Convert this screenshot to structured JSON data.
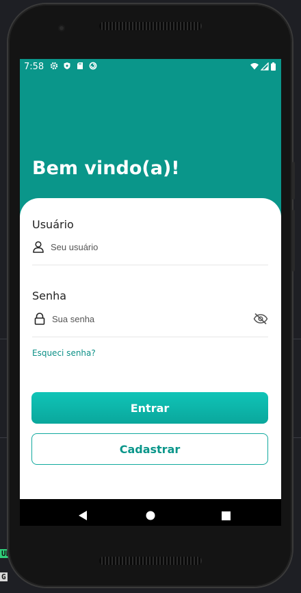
{
  "status_bar": {
    "time": "7:58",
    "left_icons": [
      "settings-icon",
      "shield-icon",
      "sd-card-icon",
      "sync-icon"
    ],
    "right_icons": [
      "wifi-icon",
      "signal-icon",
      "battery-icon"
    ]
  },
  "header": {
    "welcome": "Bem vindo(a)!"
  },
  "form": {
    "username": {
      "label": "Usuário",
      "placeholder": "Seu usuário",
      "value": ""
    },
    "password": {
      "label": "Senha",
      "placeholder": "Sua senha",
      "value": ""
    },
    "forgot_link": "Esqueci senha?",
    "login_button": "Entrar",
    "register_button": "Cadastrar"
  },
  "nav_bar": {
    "buttons": [
      "back-icon",
      "home-icon",
      "recents-icon"
    ]
  },
  "colors": {
    "primary": "#0a968a",
    "button_gradient_top": "#10c4b7",
    "link": "#0a8f86"
  }
}
